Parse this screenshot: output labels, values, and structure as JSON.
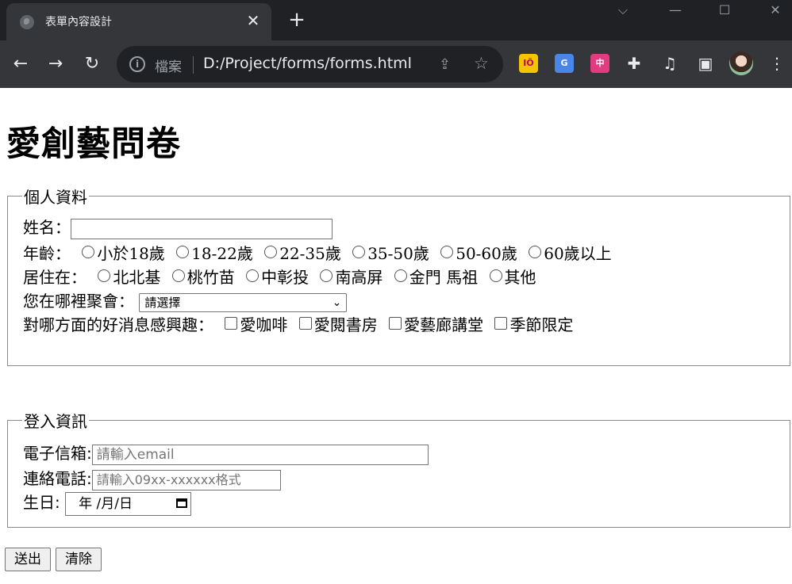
{
  "browser": {
    "tab_title": "表單內容設計",
    "tab_close": "✕",
    "new_tab": "+",
    "omnibox_label": "檔案",
    "url": "D:/Project/forms/forms.html"
  },
  "page": {
    "heading": "愛創藝問卷",
    "personal": {
      "legend": "個人資料",
      "name_label": "姓名：",
      "age_label": "年齡：",
      "age_options": [
        "小於18歲",
        "18-22歲",
        "22-35歲",
        "35-50歲",
        "50-60歲",
        "60歲以上"
      ],
      "residence_label": "居住在：",
      "residence_options": [
        "北北基",
        "桃竹苗",
        "中彰投",
        "南高屏",
        "金門 馬祖",
        "其他"
      ],
      "gather_label": "您在哪裡聚會：",
      "gather_selected": "請選擇",
      "interest_label": "對哪方面的好消息感興趣：",
      "interest_options": [
        "愛咖啡",
        "愛閱書房",
        "愛藝廊講堂",
        "季節限定"
      ]
    },
    "login": {
      "legend": "登入資訊",
      "email_label": "電子信箱:",
      "email_placeholder": "請輸入email",
      "phone_label": "連絡電話:",
      "phone_placeholder": "請輸入09xx-xxxxxx格式",
      "birthday_label": "生日:",
      "birthday_value": "年 /月/日"
    },
    "submit_label": "送出",
    "reset_label": "清除"
  }
}
